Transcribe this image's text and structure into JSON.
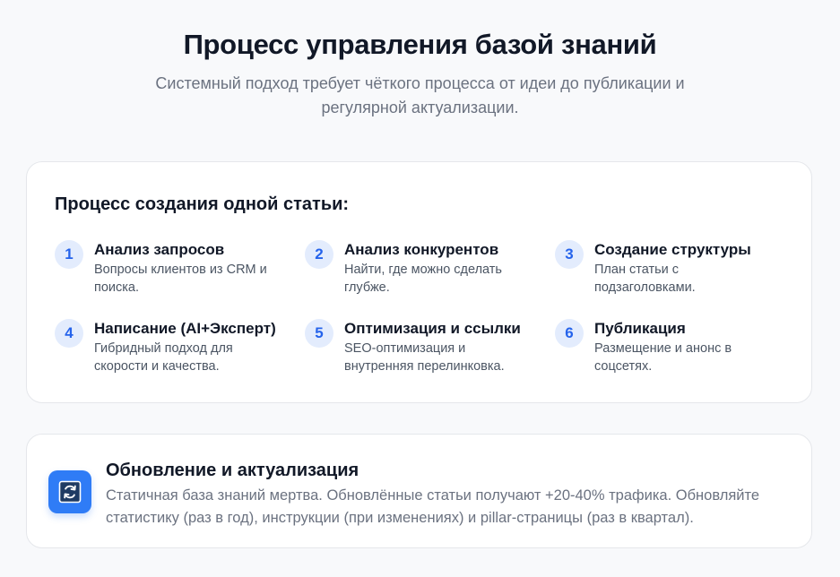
{
  "header": {
    "title": "Процесс управления базой знаний",
    "subtitle": "Системный подход требует чёткого процесса от идеи до публикации и регулярной актуализации."
  },
  "process": {
    "title": "Процесс создания одной статьи:",
    "steps": [
      {
        "number": "1",
        "title": "Анализ запросов",
        "description": "Вопросы клиентов из CRM и поиска."
      },
      {
        "number": "2",
        "title": "Анализ конкурентов",
        "description": "Найти, где можно сделать глубже."
      },
      {
        "number": "3",
        "title": "Создание структуры",
        "description": "План статьи с подзаголовками."
      },
      {
        "number": "4",
        "title": "Написание (AI+Эксперт)",
        "description": "Гибридный подход для скорости и качества."
      },
      {
        "number": "5",
        "title": "Оптимизация и ссылки",
        "description": "SEO-оптимизация и внутренняя перелинковка."
      },
      {
        "number": "6",
        "title": "Публикация",
        "description": "Размещение и анонс в соцсетях."
      }
    ]
  },
  "update": {
    "icon": "refresh-icon",
    "title": "Обновление и актуализация",
    "description": "Статичная база знаний мертва. Обновлённые статьи получают +20-40% трафика. Обновляйте статистику (раз в год), инструкции (при изменениях) и pillar-страницы (раз в квартал)."
  },
  "colors": {
    "accent": "#2563eb",
    "step_badge_bg": "#e3ecfd",
    "icon_bg": "#2f7cf6"
  }
}
